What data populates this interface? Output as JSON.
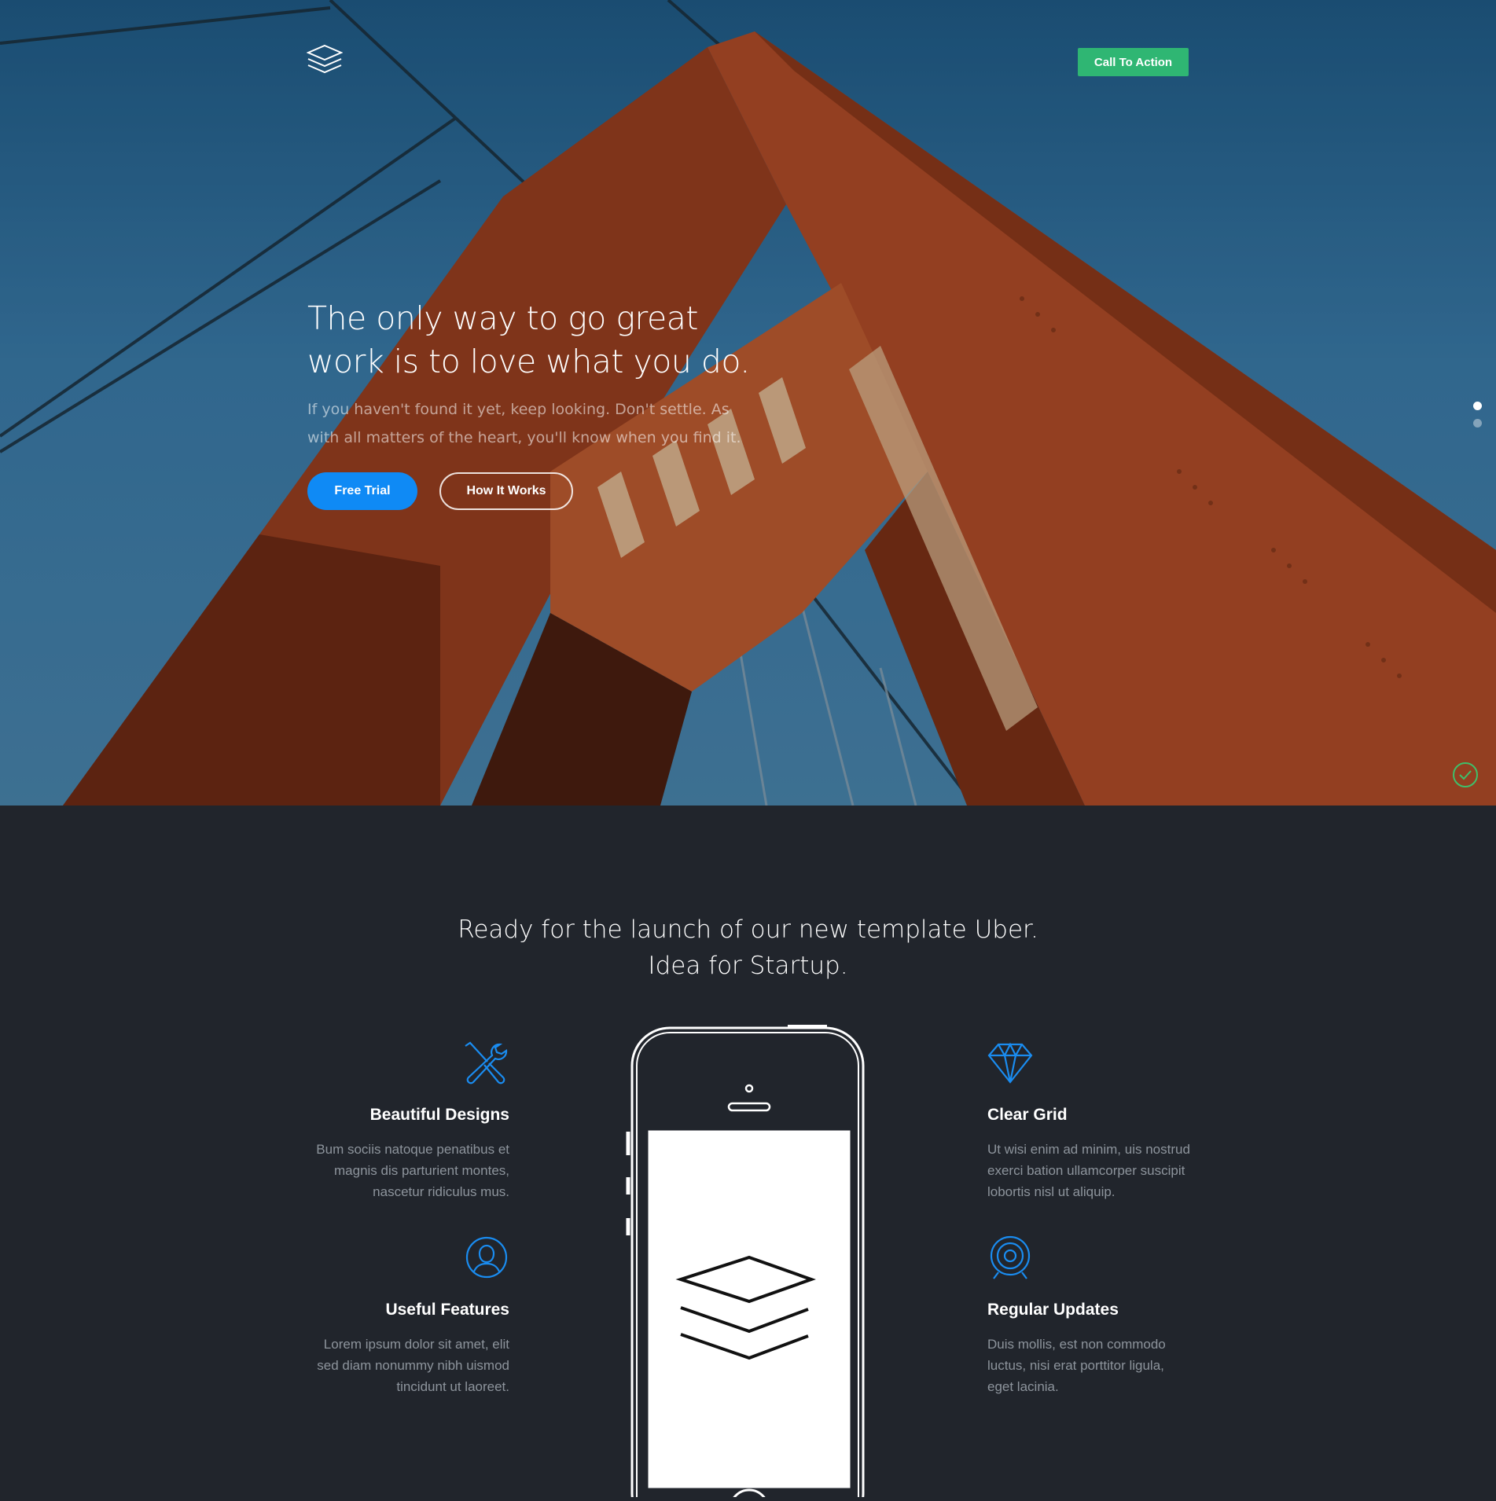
{
  "header": {
    "logo": "layers-logo",
    "cta_label": "Call To Action"
  },
  "hero": {
    "headline": "The only way to go great work is to love what you do.",
    "subline": "If you haven't found it yet, keep looking. Don't settle. As with all matters of the heart, you'll know when you find it.",
    "primary_button": "Free Trial",
    "secondary_button": "How It Works",
    "slider_active_index": 0,
    "slider_count": 2
  },
  "features": {
    "title_line1": "Ready for the launch of our new template Uber.",
    "title_line2": "Idea for Startup.",
    "items": [
      {
        "icon": "tools-icon",
        "title": "Beautiful Designs",
        "text": "Bum sociis natoque penatibus et magnis dis parturient montes, nascetur ridiculus mus."
      },
      {
        "icon": "user-icon",
        "title": "Useful Features",
        "text": "Lorem ipsum dolor sit amet, elit sed diam nonummy nibh uismod tincidunt ut laoreet."
      },
      {
        "icon": "diamond-icon",
        "title": "Clear Grid",
        "text": "Ut wisi enim ad minim, uis nostrud exerci bation ullamcorper suscipit lobortis nisl ut aliquip."
      },
      {
        "icon": "target-icon",
        "title": "Regular Updates",
        "text": "Duis mollis, est non commodo luctus, nisi erat porttitor ligula, eget lacinia."
      }
    ]
  },
  "colors": {
    "accent_blue": "#0f8af5",
    "cta_green": "#2fb673",
    "dark_bg": "#21252c"
  }
}
